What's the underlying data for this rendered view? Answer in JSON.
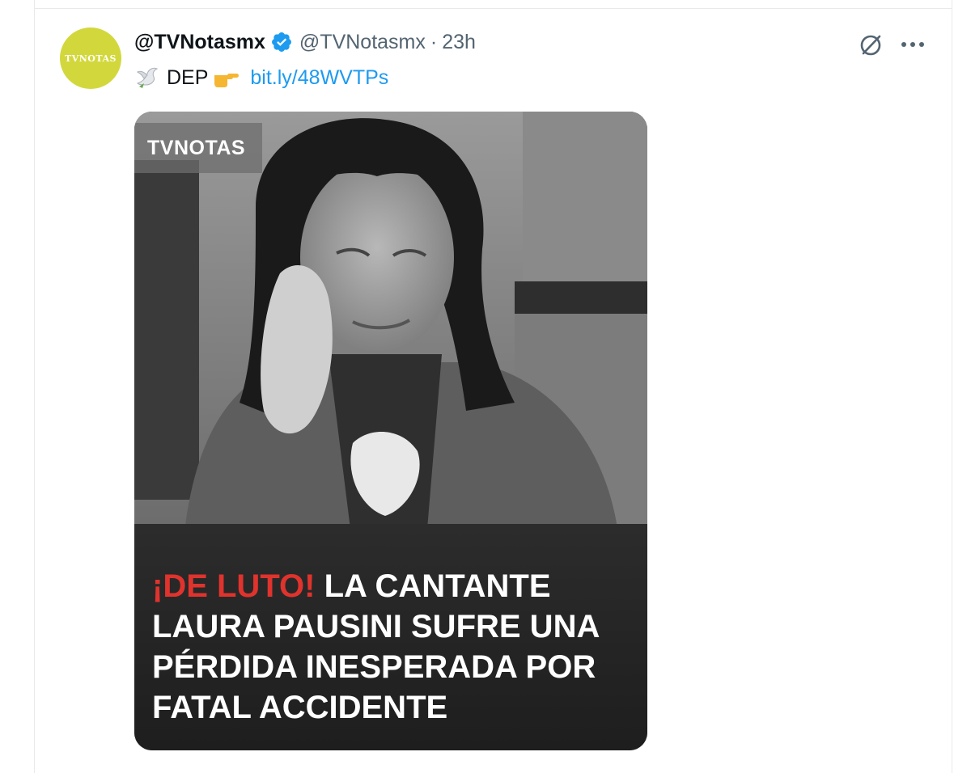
{
  "tweet": {
    "display_name": "@TVNotasmx",
    "handle": "@TVNotasmx",
    "separator": "·",
    "time": "23h",
    "avatar_text": "TVNOTAS",
    "text_prefix": "DEP",
    "link_text": "bit.ly/48WVTPs"
  },
  "icons": {
    "verified": "verified-badge-icon",
    "grok": "grok-icon",
    "more": "more-icon",
    "dove": "dove-emoji-icon",
    "pointing_hand": "pointing-right-emoji-icon"
  },
  "media": {
    "brand_tag": "TVNOTAS",
    "headline_highlight": "¡DE LUTO!",
    "headline_rest": " LA CANTANTE LAURA PAUSINI SUFRE UNA PÉRDIDA INESPERADA POR FATAL ACCIDENTE"
  },
  "colors": {
    "link": "#1d9bf0",
    "text": "#0f1419",
    "secondary": "#536471",
    "verified": "#1d9bf0",
    "avatar_bg": "#d2d83c",
    "headline_highlight": "#e0332d"
  }
}
